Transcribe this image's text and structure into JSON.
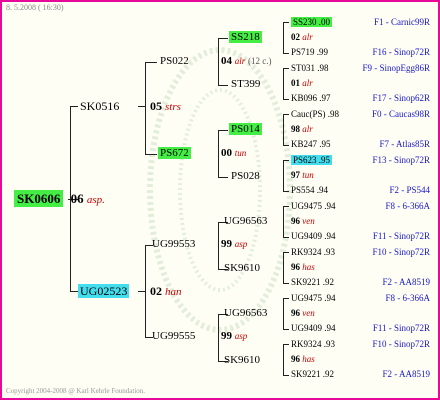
{
  "header": "8. 5.2008 ( 16:30)",
  "footer": "Copyright 2004-2008 @ Karl Kehrle Foundation.",
  "root": {
    "id": "SK0606",
    "year": "06",
    "tag": "asp."
  },
  "sire": {
    "id": "SK0516",
    "year": "05",
    "tag": "strs"
  },
  "dam": {
    "id": "UG02523",
    "year": "02",
    "tag": "han"
  },
  "ss": {
    "id": "PS022",
    "year": "04",
    "tag": "alr",
    "note": "(12 c.)"
  },
  "sd": {
    "id": "PS672",
    "year": "00",
    "tag": "tun"
  },
  "ds": {
    "id": "UG99553",
    "year": "99",
    "tag": "asp"
  },
  "dd": {
    "id": "UG99555",
    "year": "99",
    "tag": "asp"
  },
  "g3": [
    {
      "id": "SS218",
      "year": "02",
      "tag": "alr"
    },
    {
      "id": "ST399",
      "year": "01",
      "tag": "alr"
    },
    {
      "id": "PS014",
      "year": "98",
      "tag": "alr"
    },
    {
      "id": "PS028",
      "year": "97",
      "tag": "tun"
    },
    {
      "id": "UG96563",
      "year": "96",
      "tag": "ven"
    },
    {
      "id": "SK9610",
      "year": "96",
      "tag": "has"
    },
    {
      "id": "UG96563",
      "year": "96",
      "tag": "ven"
    },
    {
      "id": "SK9610",
      "year": "96",
      "tag": "has"
    }
  ],
  "g4": [
    {
      "id": "SS230 .00",
      "right": "F1 - Carnic99R"
    },
    {
      "id": "PS719 .99",
      "right": "F16 - Sinop72R"
    },
    {
      "id": "ST031 .98",
      "right": "F9 - SinopEgg86R"
    },
    {
      "id": "KB096 .97",
      "right": "F17 - Sinop62R"
    },
    {
      "id": "Cauc(PS) .98",
      "right": "F0 - Caucas98R"
    },
    {
      "id": "KB247 .95",
      "right": "F7 - Atlas85R"
    },
    {
      "id": "PS623 .95",
      "right": "F13 - Sinop72R"
    },
    {
      "id": "PS554 .94",
      "right": "F2 - PS544"
    },
    {
      "id": "UG9475 .94",
      "right": "F8 - 6-366A"
    },
    {
      "id": "UG9409 .94",
      "right": "F11 - Sinop72R"
    },
    {
      "id": "RK9324 .93",
      "right": "F10 - Sinop72R"
    },
    {
      "id": "SK9221 .92",
      "right": "F2 - AA8519"
    },
    {
      "id": "UG9475 .94",
      "right": "F8 - 6-366A"
    },
    {
      "id": "UG9409 .94",
      "right": "F11 - Sinop72R"
    },
    {
      "id": "RK9324 .93",
      "right": "F10 - Sinop72R"
    },
    {
      "id": "SK9221 .92",
      "right": "F2 - AA8519"
    }
  ]
}
